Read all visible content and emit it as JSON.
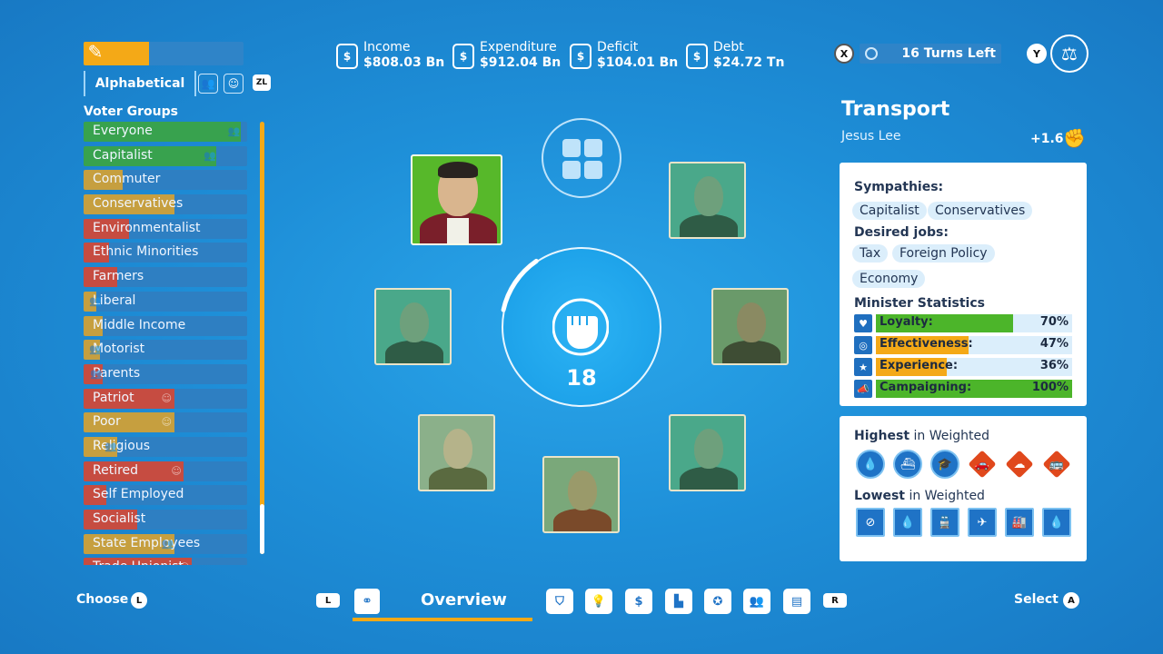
{
  "sort": {
    "label": "Alphabetical"
  },
  "progress": {
    "fraction": 0.41
  },
  "voter_groups": {
    "title": "Voter Groups",
    "items": [
      {
        "label": "Everyone",
        "color": "#3aa83a",
        "fill": 0.97
      },
      {
        "label": "Capitalist",
        "color": "#3aa83a",
        "fill": 0.82
      },
      {
        "label": "Commuter",
        "color": "#e0a528",
        "fill": 0.24
      },
      {
        "label": "Conservatives",
        "color": "#e0a528",
        "fill": 0.56
      },
      {
        "label": "Environmentalist",
        "color": "#e0432a",
        "fill": 0.28
      },
      {
        "label": "Ethnic Minorities",
        "color": "#e0432a",
        "fill": 0.16
      },
      {
        "label": "Farmers",
        "color": "#e0432a",
        "fill": 0.21
      },
      {
        "label": "Liberal",
        "color": "#e0a528",
        "fill": 0.08
      },
      {
        "label": "Middle Income",
        "color": "#e0a528",
        "fill": 0.12
      },
      {
        "label": "Motorist",
        "color": "#e0a528",
        "fill": 0.1
      },
      {
        "label": "Parents",
        "color": "#e0432a",
        "fill": 0.12
      },
      {
        "label": "Patriot",
        "color": "#e0432a",
        "fill": 0.56
      },
      {
        "label": "Poor",
        "color": "#e0a528",
        "fill": 0.56
      },
      {
        "label": "Religious",
        "color": "#e0a528",
        "fill": 0.21
      },
      {
        "label": "Retired",
        "color": "#e0432a",
        "fill": 0.62
      },
      {
        "label": "Self Employed",
        "color": "#e0432a",
        "fill": 0.14
      },
      {
        "label": "Socialist",
        "color": "#e0432a",
        "fill": 0.33
      },
      {
        "label": "State Employees",
        "color": "#e0a528",
        "fill": 0.56
      },
      {
        "label": "Trade Unionist",
        "color": "#e0432a",
        "fill": 0.67
      }
    ]
  },
  "budget": {
    "income": {
      "label": "Income",
      "value": "$808.03 Bn",
      "icon": "income-icon"
    },
    "expenditure": {
      "label": "Expenditure",
      "value": "$912.04 Bn",
      "icon": "expenditure-icon"
    },
    "deficit": {
      "label": "Deficit",
      "value": "$104.01 Bn",
      "icon": "deficit-icon"
    },
    "debt": {
      "label": "Debt",
      "value": "$24.72 Tn",
      "icon": "debt-icon"
    }
  },
  "turns": {
    "text": "16 Turns Left"
  },
  "buttons": {
    "x": "X",
    "y": "Y",
    "zl": "ZL",
    "l": "L",
    "r": "R",
    "choose_btn": "L",
    "select_btn": "A"
  },
  "center": {
    "count": "18",
    "ring_fraction": 0.12
  },
  "department": {
    "title": "Transport",
    "minister": "Jesus Lee",
    "power": "+1.6"
  },
  "card": {
    "sympathies_label": "Sympathies:",
    "sympathies": [
      "Capitalist",
      "Conservatives"
    ],
    "desired_label": "Desired jobs:",
    "desired": [
      "Tax",
      "Foreign Policy",
      "Economy"
    ],
    "stats_label": "Minister Statistics",
    "stats": [
      {
        "label": "Loyalty:",
        "value": "70%",
        "fraction": 0.7,
        "color": "#4cb52a",
        "icon": "heart-icon"
      },
      {
        "label": "Effectiveness:",
        "value": "47%",
        "fraction": 0.47,
        "color": "#f4a917",
        "icon": "target-icon"
      },
      {
        "label": "Experience:",
        "value": "36%",
        "fraction": 0.36,
        "color": "#f4a917",
        "icon": "star-icon"
      },
      {
        "label": "Campaigning:",
        "value": "100%",
        "fraction": 1.0,
        "color": "#4cb52a",
        "icon": "megaphone-icon"
      }
    ]
  },
  "weighted": {
    "highest_bold": "Highest",
    "highest_rest": " in Weighted",
    "lowest_bold": "Lowest",
    "lowest_rest": " in Weighted"
  },
  "footer": {
    "choose": "Choose",
    "select": "Select",
    "tab_label": "Overview"
  }
}
